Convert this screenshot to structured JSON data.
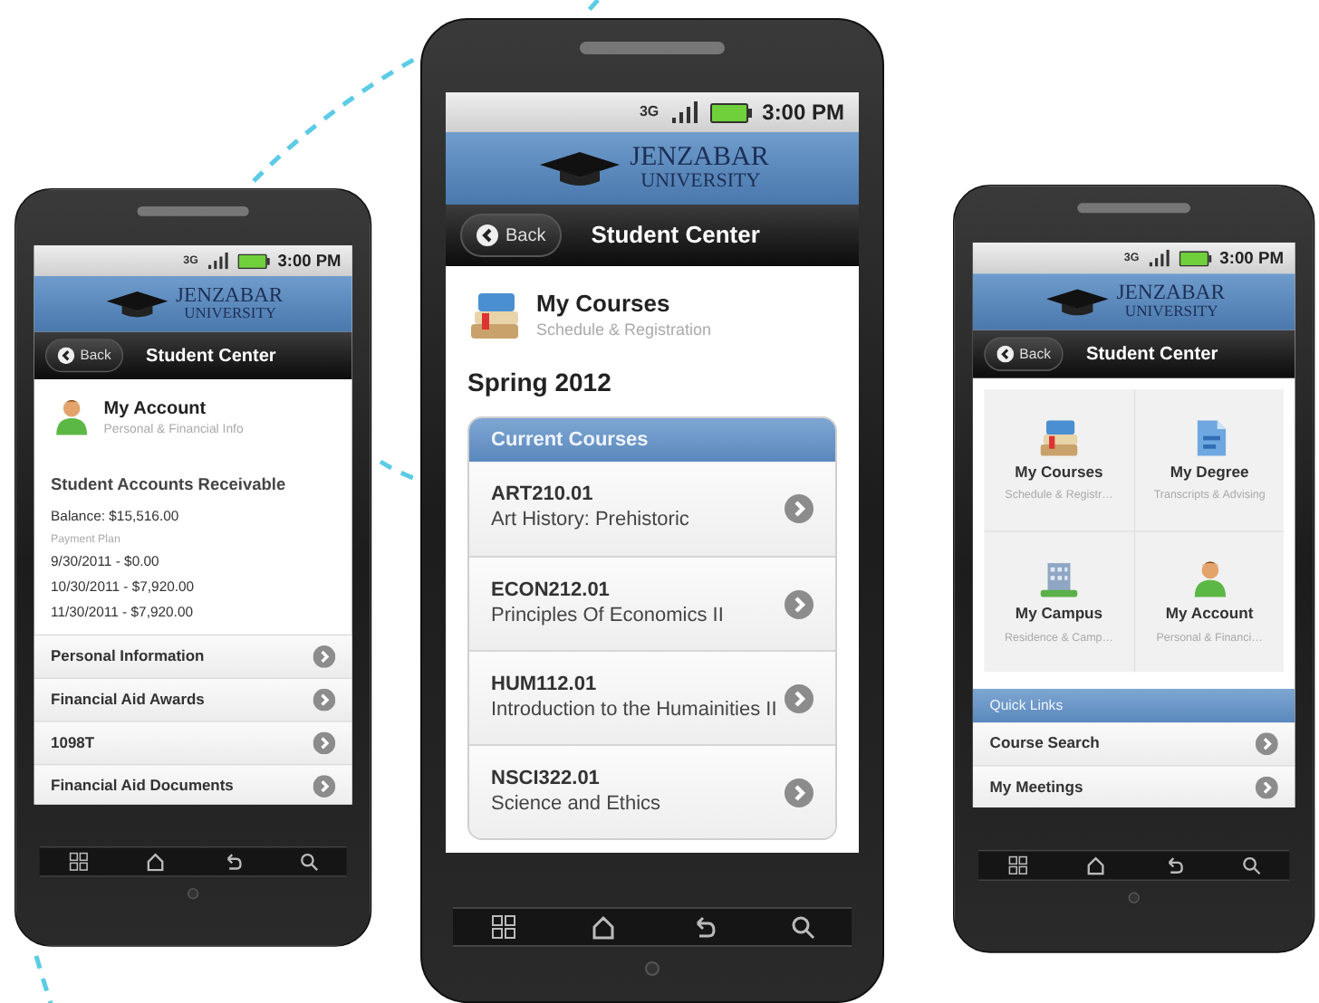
{
  "phones": [
    {
      "status_bar": {
        "network": "3G",
        "time": "3:00 PM"
      },
      "logo": {
        "line_1": "JENZABAR",
        "line_2": "UNIVERSITY"
      },
      "nav_bar": {
        "back": "Back",
        "title": "Student Center"
      },
      "screen": {
        "kind": "account",
        "header": {
          "title": "My Account",
          "subtitle": "Personal & Financial Info"
        },
        "section_title": "Student Accounts Receivable",
        "balance": "Balance: $15,516.00",
        "plan_label": "Payment Plan",
        "payments": [
          "9/30/2011 - $0.00",
          "10/30/2011 - $7,920.00",
          "11/30/2011 - $7,920.00"
        ],
        "links": [
          "Personal Information",
          "Financial Aid Awards",
          "1098T",
          "Financial Aid Documents"
        ]
      }
    },
    {
      "status_bar": {
        "network": "3G",
        "time": "3:00 PM"
      },
      "logo": {
        "line_1": "JENZABAR",
        "line_2": "UNIVERSITY"
      },
      "nav_bar": {
        "back": "Back",
        "title": "Student Center"
      },
      "screen": {
        "kind": "courses",
        "header": {
          "title": "My Courses",
          "subtitle": "Schedule & Registration"
        },
        "term": "Spring 2012",
        "panel_title": "Current Courses",
        "courses": [
          {
            "code": "ART210.01",
            "name": "Art History: Prehistoric"
          },
          {
            "code": "ECON212.01",
            "name": "Principles Of Economics II"
          },
          {
            "code": "HUM112.01",
            "name": "Introduction to the Humainities II"
          },
          {
            "code": "NSCI322.01",
            "name": "Science and Ethics"
          }
        ]
      }
    },
    {
      "status_bar": {
        "network": "3G",
        "time": "3:00 PM"
      },
      "logo": {
        "line_1": "JENZABAR",
        "line_2": "UNIVERSITY"
      },
      "nav_bar": {
        "back": "Back",
        "title": "Student Center"
      },
      "screen": {
        "kind": "dashboard",
        "tiles": [
          {
            "kind": "courses",
            "title": "My Courses",
            "subtitle": "Schedule & Registr…"
          },
          {
            "kind": "degree",
            "title": "My Degree",
            "subtitle": "Transcripts & Advising"
          },
          {
            "kind": "campus",
            "title": "My Campus",
            "subtitle": "Residence & Camp…"
          },
          {
            "kind": "account",
            "title": "My Account",
            "subtitle": "Personal & Financi…"
          }
        ],
        "quick_links_title": "Quick Links",
        "links": [
          "Course Search",
          "My Meetings"
        ]
      }
    }
  ]
}
